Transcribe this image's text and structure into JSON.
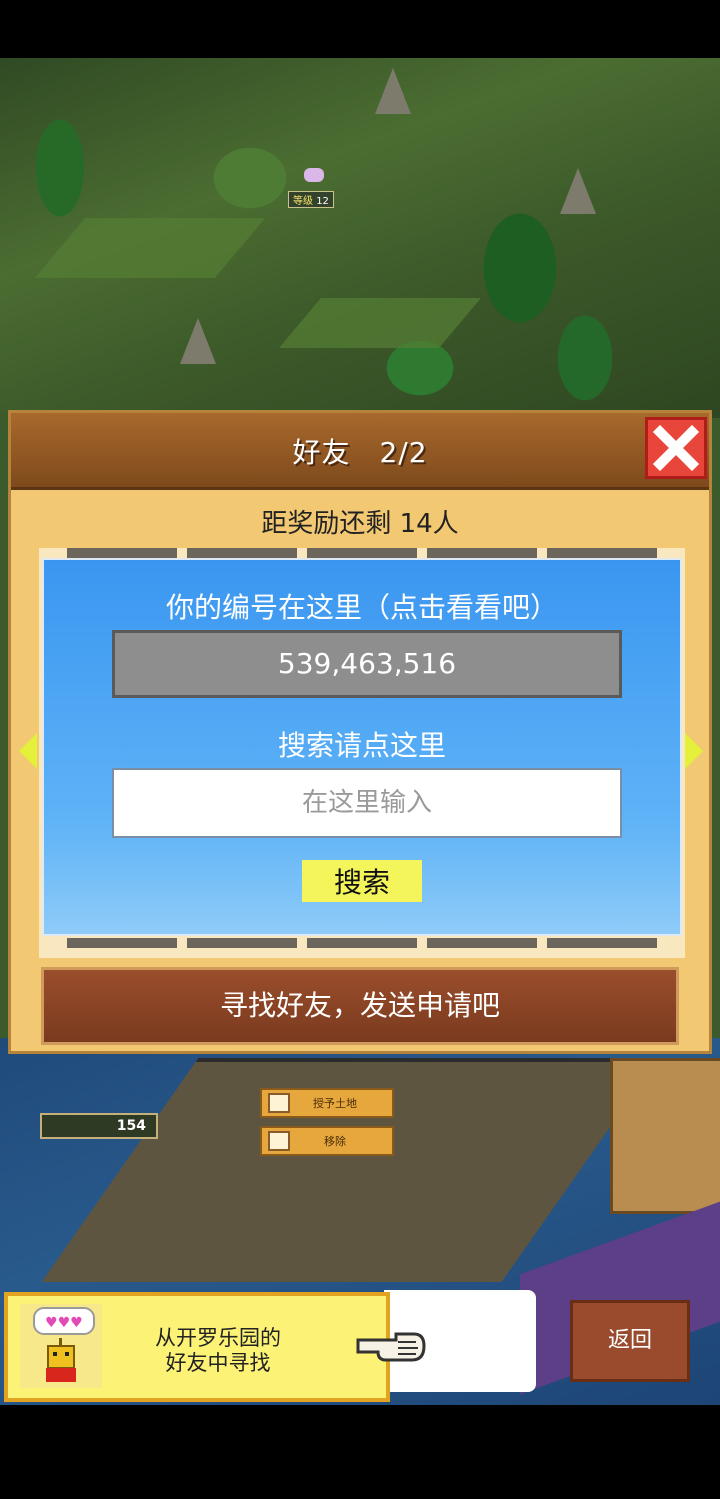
{
  "world": {
    "level_label": "等级",
    "level_value": "12",
    "resource_count": "154",
    "menu": [
      {
        "label": "授予土地"
      },
      {
        "label": "移除"
      }
    ]
  },
  "modal": {
    "title": "好友　2/2",
    "reward_text": "距奖励还剩 14人",
    "id_label": "你的编号在这里（点击看看吧）",
    "id_value": "539,463,516",
    "search_label": "搜索请点这里",
    "search_placeholder": "在这里输入",
    "search_button": "搜索",
    "find_button": "寻找好友，发送申请吧"
  },
  "banner": {
    "line1": "从开罗乐园的",
    "line2": "好友中寻找"
  },
  "back_button": "返回",
  "colors": {
    "modal_bg": "#f2c873",
    "header_brown": "#8a5422",
    "panel_blue": "#3a96f0",
    "close_red": "#e8463a",
    "search_yellow": "#f3f55a",
    "banner_yellow": "#fbf276"
  },
  "icons": [
    "close-icon",
    "arrow-left-icon",
    "arrow-right-icon",
    "house-icon",
    "kairo-character-icon",
    "pointing-hand-icon"
  ]
}
